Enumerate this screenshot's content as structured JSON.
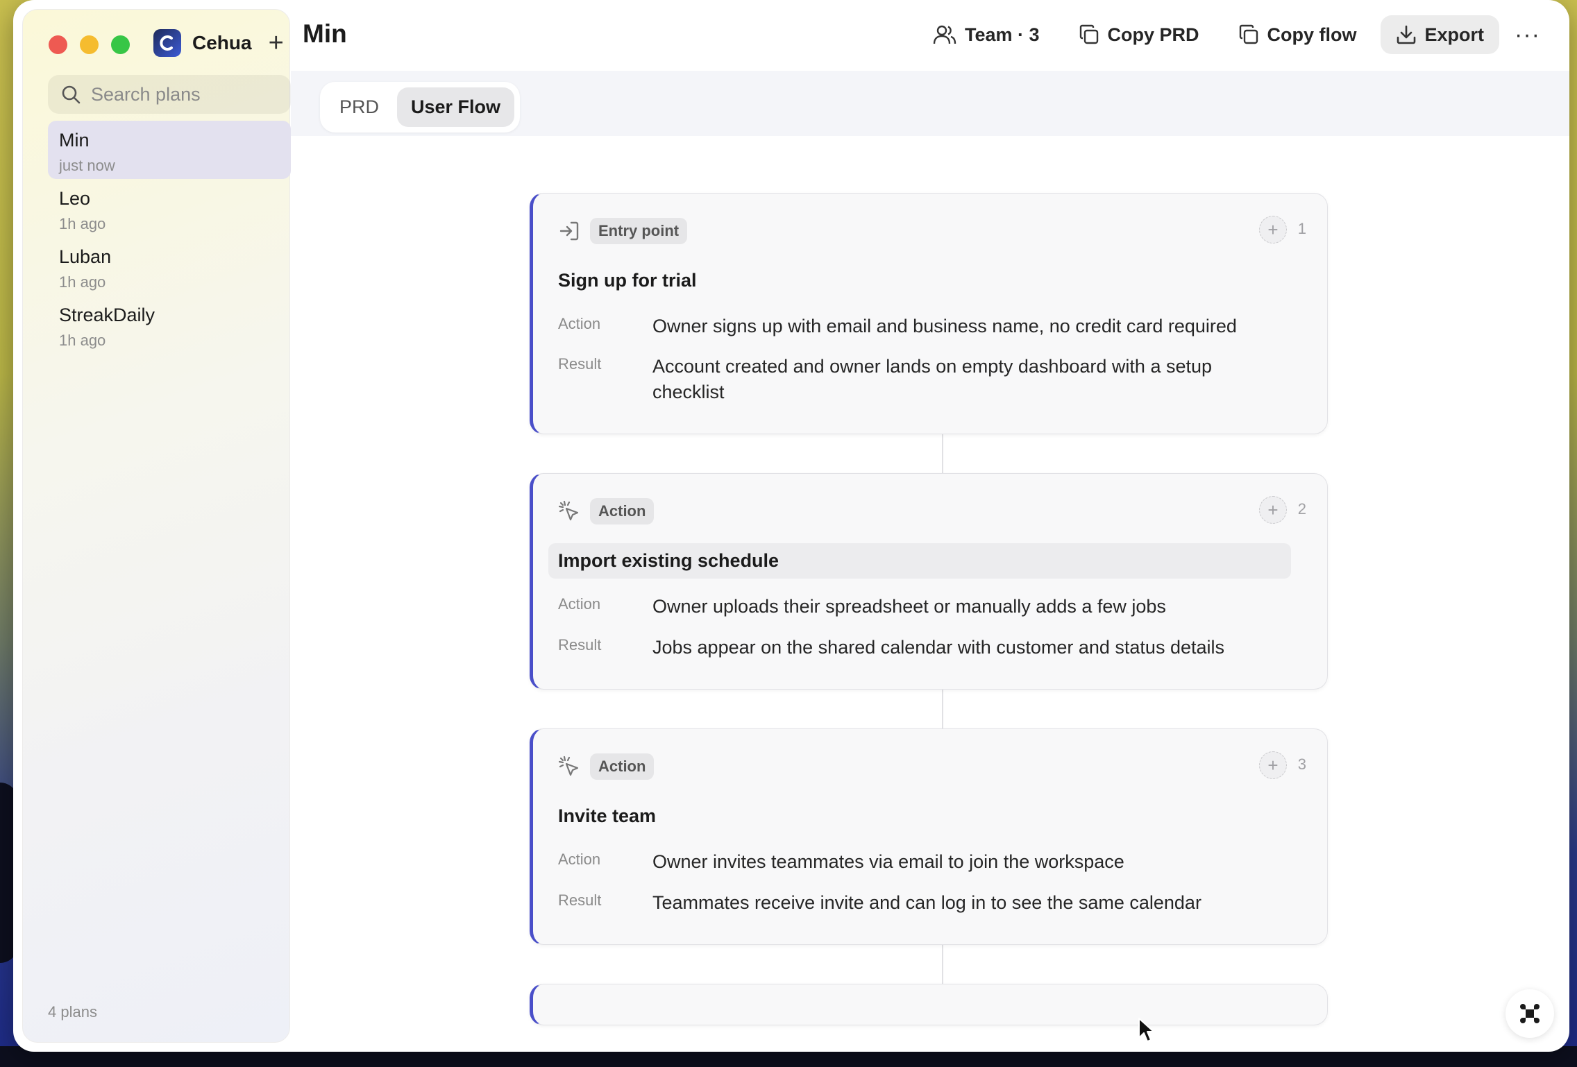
{
  "app": {
    "name": "Cehua"
  },
  "sidebar": {
    "search_placeholder": "Search plans",
    "plans": [
      {
        "name": "Min",
        "time": "just now",
        "active": true
      },
      {
        "name": "Leo",
        "time": "1h ago",
        "active": false
      },
      {
        "name": "Luban",
        "time": "1h ago",
        "active": false
      },
      {
        "name": "StreakDaily",
        "time": "1h ago",
        "active": false
      }
    ],
    "count_label": "4 plans"
  },
  "header": {
    "title": "Min",
    "team_label": "Team · 3",
    "copy_prd_label": "Copy PRD",
    "copy_flow_label": "Copy flow",
    "export_label": "Export",
    "more_label": "···"
  },
  "tabs": [
    {
      "label": "PRD",
      "active": false
    },
    {
      "label": "User Flow",
      "active": true
    }
  ],
  "flow": {
    "steps": [
      {
        "type": "Entry point",
        "number": "1",
        "title": "Sign up for trial",
        "action_label": "Action",
        "action": "Owner signs up with email and business name, no credit card required",
        "result_label": "Result",
        "result": "Account created and owner lands on empty dashboard with a setup checklist"
      },
      {
        "type": "Action",
        "number": "2",
        "title": "Import existing schedule",
        "action_label": "Action",
        "action": "Owner uploads their spreadsheet or manually adds a few jobs",
        "result_label": "Result",
        "result": "Jobs appear on the shared calendar with customer and status details"
      },
      {
        "type": "Action",
        "number": "3",
        "title": "Invite team",
        "action_label": "Action",
        "action": "Owner invites teammates via email to join the workspace",
        "result_label": "Result",
        "result": "Teammates receive invite and can log in to see the same calendar"
      }
    ]
  },
  "colors": {
    "accent": "#4a4fc9"
  }
}
